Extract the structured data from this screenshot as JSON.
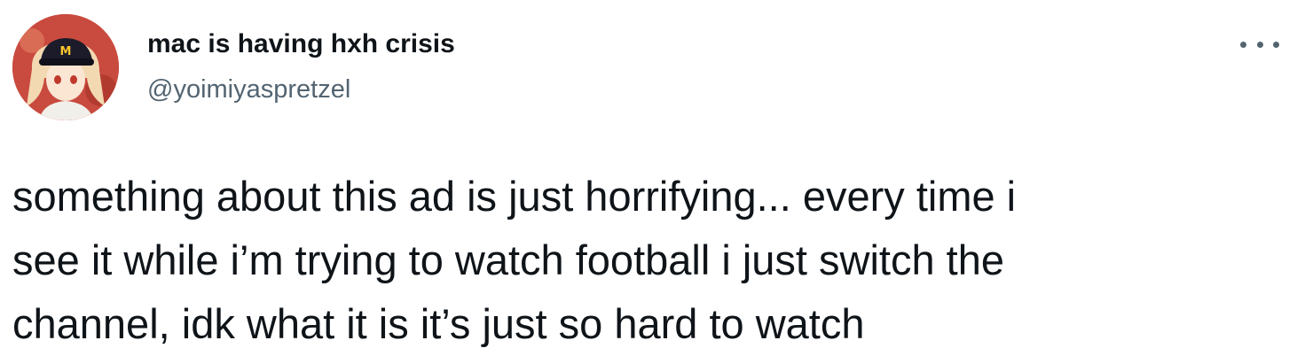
{
  "author": {
    "display_name": "mac is having hxh crisis",
    "handle": "@yoimiyaspretzel",
    "avatar_icon": "profile-avatar-image",
    "avatar_cap_logo": "M"
  },
  "menu": {
    "icon": "more-options-icon"
  },
  "tweet": {
    "text": "something about this ad is just horrifying... every time i\nsee it while i’m trying to watch football i just switch the\nchannel, idk what it is it’s just so hard to watch"
  },
  "colors": {
    "text_primary": "#0f1419",
    "text_secondary": "#536471",
    "background": "#ffffff"
  }
}
